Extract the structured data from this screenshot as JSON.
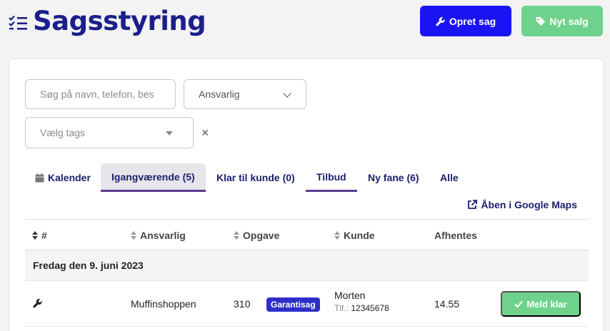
{
  "header": {
    "title": "Sagsstyring",
    "create_case_label": "Opret sag",
    "new_sale_label": "Nyt salg",
    "colors": {
      "title": "#1b1f8a",
      "primary": "#1a14f5",
      "green": "#6fd28c"
    }
  },
  "filters": {
    "search_placeholder": "Søg på navn, telefon, beskrivelse",
    "search_display": "Søg på navn, telefon, bes",
    "responsible_label": "Ansvarlig",
    "tags_placeholder": "Vælg tags",
    "clear_symbol": "×"
  },
  "tabs": [
    {
      "label": "Kalender"
    },
    {
      "label": "Igangværende (5)"
    },
    {
      "label": "Klar til kunde (0)"
    },
    {
      "label": "Tilbud"
    },
    {
      "label": "Ny fane (6)"
    },
    {
      "label": "Alle"
    }
  ],
  "maps_link": "Åben i Google Maps",
  "table": {
    "columns": [
      "#",
      "Ansvarlig",
      "Opgave",
      "Kunde",
      "Afhentes"
    ],
    "groups": [
      {
        "label": "Fredag den 9. juni 2023",
        "rows": [
          {
            "icon": "wrench-icon",
            "responsible": "Muffinshoppen",
            "task": "310",
            "badge": "Garantisag",
            "customer_name": "Morten",
            "phone_label": "Tlf.:",
            "phone": "12345678",
            "pickup": "14.55",
            "action_label": "Meld klar"
          }
        ]
      }
    ]
  }
}
